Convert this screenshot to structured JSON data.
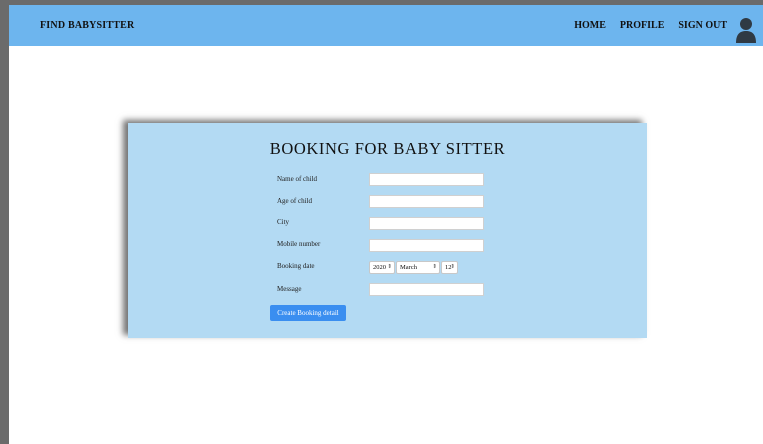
{
  "navbar": {
    "brand": "FIND BABYSITTER",
    "links": [
      "HOME",
      "PROFILE",
      "SIGN OUT"
    ],
    "user_icon": "user-silhouette-icon"
  },
  "form": {
    "title": "BOOKING FOR BABY SITTER",
    "fields": [
      {
        "label": "Name of child",
        "value": ""
      },
      {
        "label": "Age of child",
        "value": ""
      },
      {
        "label": "City",
        "value": ""
      },
      {
        "label": "Mobile number",
        "value": ""
      },
      {
        "label": "Booking date"
      },
      {
        "label": "Message",
        "value": ""
      }
    ],
    "booking_date": {
      "year": "2020",
      "month": "March",
      "day": "12"
    },
    "submit_label": "Create Booking detail"
  },
  "colors": {
    "navbar_bg": "#6db5ee",
    "card_bg": "#b3daf3",
    "button_bg": "#3a8ef0"
  }
}
